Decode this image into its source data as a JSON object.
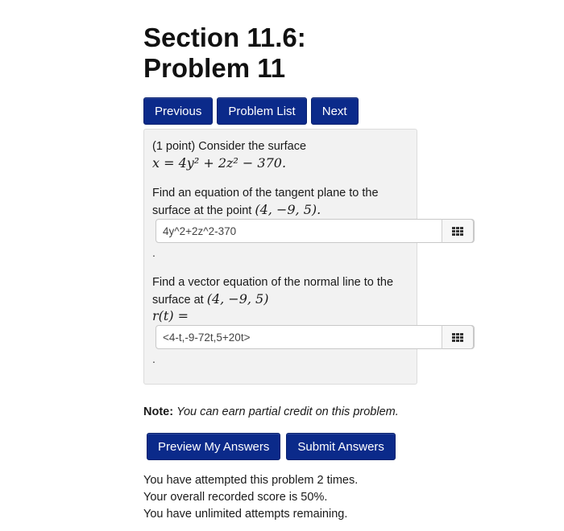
{
  "header": {
    "title_line1": "Section 11.6:",
    "title_line2": "Problem 11"
  },
  "nav": {
    "previous": "Previous",
    "problem_list": "Problem List",
    "next": "Next"
  },
  "problem": {
    "intro": "(1 point) Consider the surface",
    "surface_equation": "x = 4y² + 2z² − 370.",
    "q1_line1": "Find an equation of the tangent plane to the",
    "q1_line2_prefix": "surface at the point",
    "point": "(4, −9, 5).",
    "answer1": {
      "value": "4y^2+2z^2-370",
      "icon": "keyboard-icon"
    },
    "separator": ".",
    "q2_line1": "Find a vector equation of the normal line to the",
    "q2_line2_prefix": "surface at",
    "point2": "(4, −9, 5)",
    "vector_label": "r(t) =",
    "answer2": {
      "value": "<4-t,-9-72t,5+20t>",
      "icon": "keyboard-icon"
    }
  },
  "note": {
    "label": "Note:",
    "text": "You can earn partial credit on this problem."
  },
  "actions": {
    "preview": "Preview My Answers",
    "submit": "Submit Answers"
  },
  "status": {
    "attempts": "You have attempted this problem 2 times.",
    "score": "Your overall recorded score is 50%.",
    "remaining": "You have unlimited attempts remaining."
  },
  "colors": {
    "button_bg": "#0b2a8a",
    "panel_bg": "#f2f2f2"
  }
}
